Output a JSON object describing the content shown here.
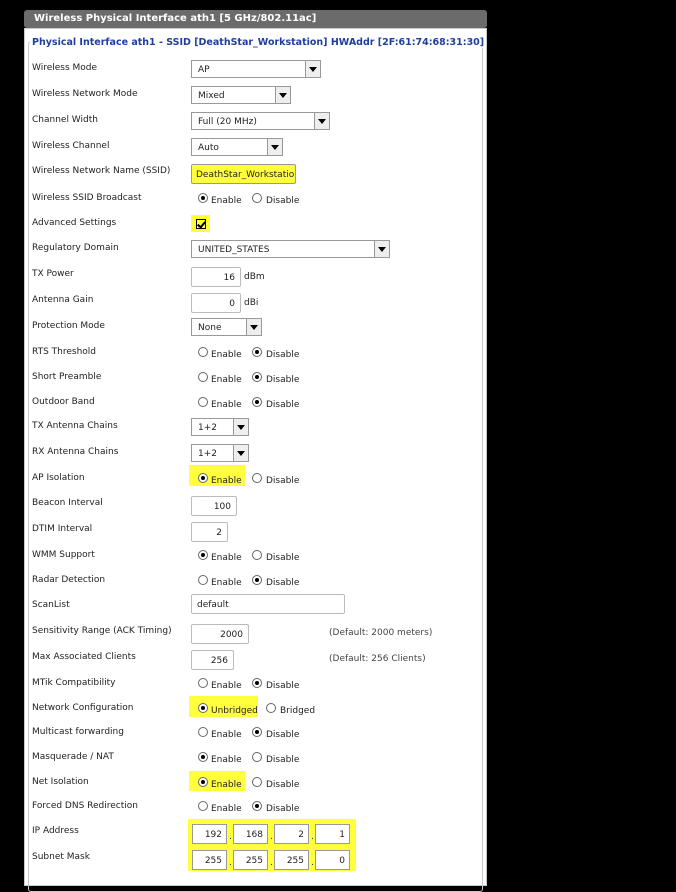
{
  "title": "Wireless Physical Interface ath1 [5 GHz/802.11ac]",
  "legend": "Physical Interface ath1 - SSID [DeathStar_Workstation] HWAddr [2F:61:74:68:31:30]",
  "labels": {
    "wireless_mode": "Wireless Mode",
    "network_mode": "Wireless Network Mode",
    "channel_width": "Channel Width",
    "wireless_channel": "Wireless Channel",
    "ssid": "Wireless Network Name (SSID)",
    "ssid_broadcast": "Wireless SSID Broadcast",
    "advanced": "Advanced Settings",
    "regdomain": "Regulatory Domain",
    "tx_power": "TX Power",
    "antenna_gain": "Antenna Gain",
    "protection": "Protection Mode",
    "rts": "RTS Threshold",
    "preamble": "Short Preamble",
    "outdoor": "Outdoor Band",
    "tx_chains": "TX Antenna Chains",
    "rx_chains": "RX Antenna Chains",
    "ap_isolation": "AP Isolation",
    "beacon": "Beacon Interval",
    "dtim": "DTIM Interval",
    "wmm": "WMM Support",
    "radar": "Radar Detection",
    "scanlist": "ScanList",
    "sensitivity": "Sensitivity Range (ACK Timing)",
    "max_clients": "Max Associated Clients",
    "mtik": "MTik Compatibility",
    "netconfig": "Network Configuration",
    "multicast": "Multicast forwarding",
    "masquerade": "Masquerade / NAT",
    "net_isolation": "Net Isolation",
    "forced_dns": "Forced DNS Redirection",
    "ip": "IP Address",
    "mask": "Subnet Mask"
  },
  "values": {
    "wireless_mode": "AP",
    "network_mode": "Mixed",
    "channel_width": "Full (20 MHz)",
    "wireless_channel": "Auto",
    "ssid": "DeathStar_Workstation",
    "regdomain": "UNITED_STATES",
    "tx_power": "16",
    "tx_power_unit": "dBm",
    "antenna_gain": "0",
    "antenna_gain_unit": "dBi",
    "protection": "None",
    "tx_chains": "1+2",
    "rx_chains": "1+2",
    "beacon": "100",
    "dtim": "2",
    "scanlist": "default",
    "sensitivity": "2000",
    "sensitivity_note": "(Default: 2000 meters)",
    "max_clients": "256",
    "max_clients_note": "(Default: 256 Clients)",
    "ip": [
      "192",
      "168",
      "2",
      "1"
    ],
    "mask": [
      "255",
      "255",
      "255",
      "0"
    ]
  },
  "options": {
    "enable": "Enable",
    "disable": "Disable",
    "unbridged": "Unbridged",
    "bridged": "Bridged"
  },
  "state": {
    "ssid_broadcast": "Enable",
    "advanced_checked": true,
    "rts": "Disable",
    "preamble": "Disable",
    "outdoor": "Disable",
    "ap_isolation": "Enable",
    "wmm": "Enable",
    "radar": "Disable",
    "mtik": "Disable",
    "netconfig": "Unbridged",
    "multicast": "Disable",
    "masquerade": "Enable",
    "net_isolation": "Enable",
    "forced_dns": "Disable"
  },
  "highlight_color": "#ffff3c"
}
